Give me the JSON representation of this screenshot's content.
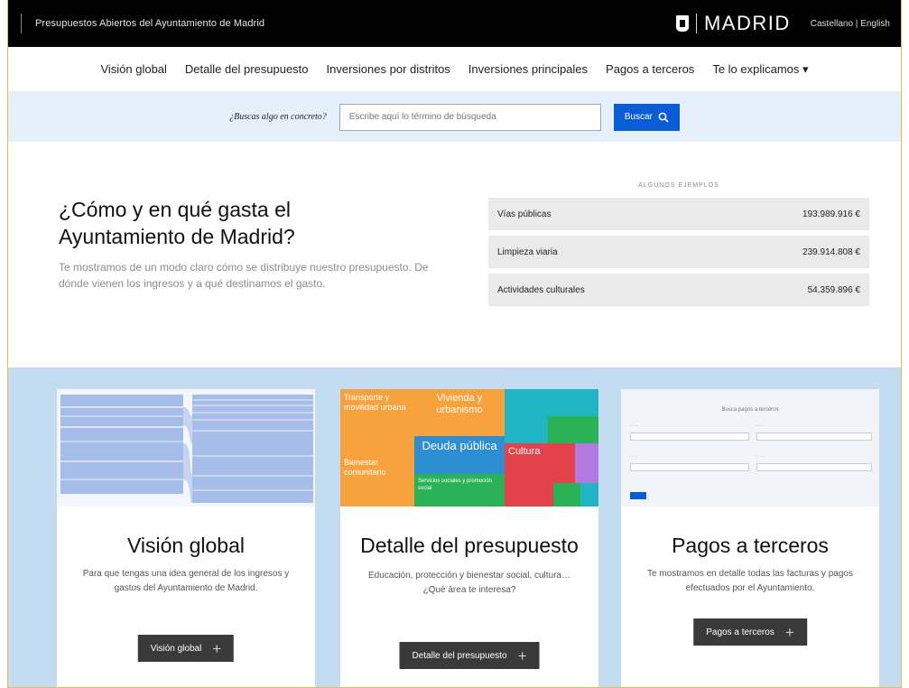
{
  "header": {
    "site_title": "Presupuestos Abiertos del Ayuntamiento de Madrid",
    "logo_text": "MADRID",
    "lang_es": "Castellano",
    "lang_sep": " | ",
    "lang_en": "English"
  },
  "nav": {
    "items": [
      "Visión global",
      "Detalle del presupuesto",
      "Inversiones por distritos",
      "Inversiones principales",
      "Pagos a terceros",
      "Te lo explicamos ▾"
    ]
  },
  "search": {
    "label": "¿Buscas algo en concreto?",
    "placeholder": "Escribe aquí lo término de búsqueda",
    "button_label": "Buscar",
    "button_icon": "search-icon"
  },
  "hero": {
    "title": "¿Cómo y en qué gasta el Ayuntamiento de Madrid?",
    "description": "Te mostramos de un modo claro cómo se distribuye nuestro presupuesto. De dónde vienen los ingresos y a qué destinamos el gasto."
  },
  "examples": {
    "header": "ALGUNOS EJEMPLOS",
    "rows": [
      {
        "label": "Vías públicas",
        "amount": "193.989.916 €"
      },
      {
        "label": "Limpieza viaria",
        "amount": "239.914.808 €"
      },
      {
        "label": "Actividades culturales",
        "amount": "54.359.896 €"
      }
    ]
  },
  "cards": [
    {
      "title": "Visión global",
      "description": "Para que tengas una idea general de los ingresos y gastos del Ayuntamiento de Madrid.",
      "button_label": "Visión global"
    },
    {
      "title": "Detalle del presupuesto",
      "description": "Educación, protección y bienestar social, cultura… ¿Qué área te interesa?",
      "button_label": "Detalle del presupuesto",
      "treemap_labels": [
        "Transporte y movilidad urbana",
        "Vivienda y urbanismo",
        "Deuda pública",
        "Cultura",
        "Servicios sociales y promoción social",
        "Bienestar comunitario"
      ]
    },
    {
      "title": "Pagos a terceros",
      "description": "Te mostramos en detalle todas las facturas y pagos efectuados por el Ayuntamiento.",
      "button_label": "Pagos a terceros",
      "form_title": "Busca pagos a terceros"
    }
  ],
  "colors": {
    "topbar": "#000000",
    "search_band": "#e6f0fb",
    "accent_blue": "#0a5bd6",
    "cards_band": "#c4dcf2",
    "button_dark": "#3a3a3a",
    "treemap_orange": "#f7a23c",
    "treemap_teal": "#1fb5c2",
    "treemap_blue": "#2d8fd1",
    "treemap_red": "#e4424a",
    "treemap_green": "#2bb256",
    "treemap_purple": "#b27ae0"
  }
}
